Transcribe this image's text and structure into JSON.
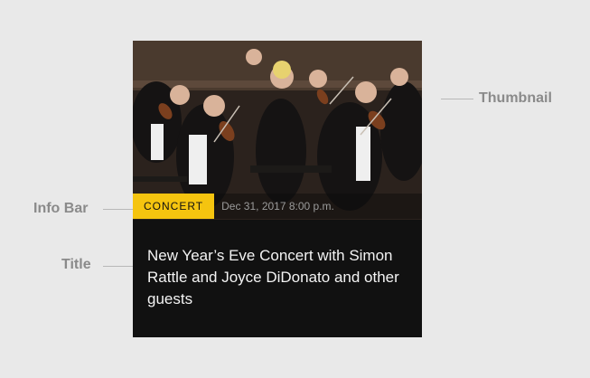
{
  "annotations": {
    "thumbnail": "Thumbnail",
    "info_bar": "Info Bar",
    "title": "Title"
  },
  "card": {
    "category": "CONCERT",
    "datetime": "Dec 31, 2017 8:00 p.m.",
    "title": "New Year’s Eve Concert with Simon Rattle and Joyce DiDonato and other guests",
    "thumbnail_icon": "concert-photo",
    "badge_color": "#F5C40F"
  }
}
